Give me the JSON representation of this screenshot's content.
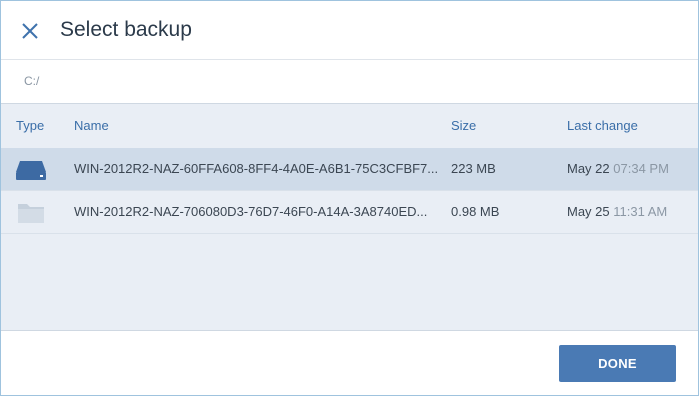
{
  "dialog": {
    "title": "Select backup",
    "path": "C:/"
  },
  "table": {
    "columns": {
      "type": "Type",
      "name": "Name",
      "size": "Size",
      "last_change": "Last change"
    },
    "rows": [
      {
        "icon": "drive-icon",
        "name": "WIN-2012R2-NAZ-60FFA608-8FF4-4A0E-A6B1-75C3CFBF7...",
        "size": "223 MB",
        "date": "May 22",
        "time": "07:34 PM",
        "selected": true
      },
      {
        "icon": "folder-icon",
        "name": "WIN-2012R2-NAZ-706080D3-76D7-46F0-A14A-3A8740ED...",
        "size": "0.98 MB",
        "date": "May 25",
        "time": "11:31 AM",
        "selected": false
      }
    ]
  },
  "footer": {
    "done_label": "DONE"
  },
  "colors": {
    "accent": "#4a7ab4",
    "header_text": "#3a6ea8",
    "selected_row": "#cfdbe9",
    "table_bg": "#e9eef5"
  }
}
